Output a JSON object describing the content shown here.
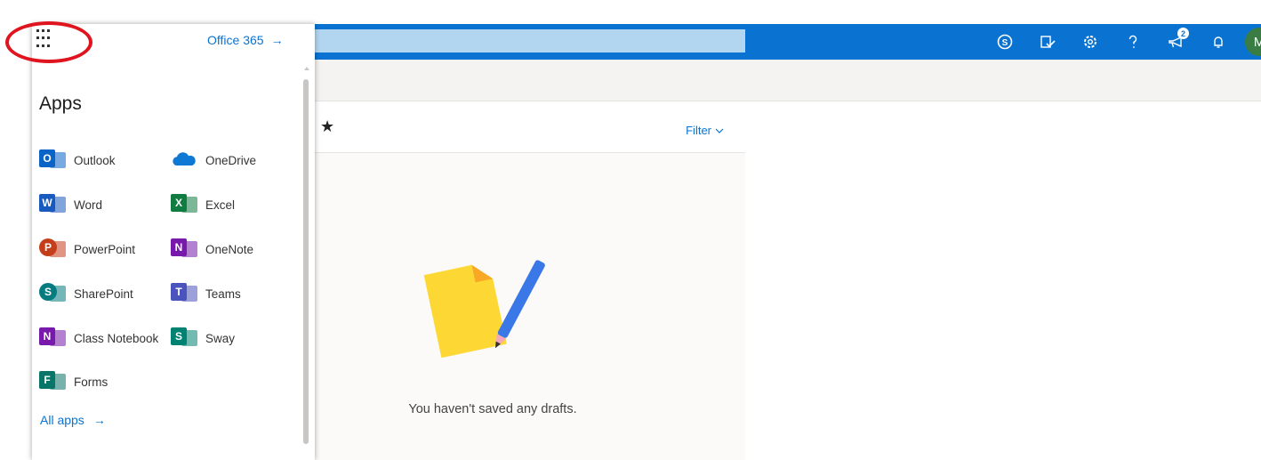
{
  "launcher": {
    "office365_label": "Office 365",
    "apps_heading": "Apps",
    "all_apps_label": "All apps",
    "apps": [
      {
        "label": "Outlook",
        "icon": "outlook-icon",
        "color": "#0a64c8",
        "letter": "O"
      },
      {
        "label": "OneDrive",
        "icon": "onedrive-icon",
        "color": "#0f78d4",
        "letter": ""
      },
      {
        "label": "Word",
        "icon": "word-icon",
        "color": "#185abd",
        "letter": "W"
      },
      {
        "label": "Excel",
        "icon": "excel-icon",
        "color": "#107c41",
        "letter": "X"
      },
      {
        "label": "PowerPoint",
        "icon": "powerpoint-icon",
        "color": "#c43e1c",
        "letter": "P"
      },
      {
        "label": "OneNote",
        "icon": "onenote-icon",
        "color": "#7719aa",
        "letter": "N"
      },
      {
        "label": "SharePoint",
        "icon": "sharepoint-icon",
        "color": "#037b7f",
        "letter": "S"
      },
      {
        "label": "Teams",
        "icon": "teams-icon",
        "color": "#4b53bc",
        "letter": "T"
      },
      {
        "label": "Class Notebook",
        "icon": "class-notebook-icon",
        "color": "#7719aa",
        "letter": "N"
      },
      {
        "label": "Sway",
        "icon": "sway-icon",
        "color": "#008272",
        "letter": "S"
      },
      {
        "label": "Forms",
        "icon": "forms-icon",
        "color": "#077568",
        "letter": "F"
      }
    ]
  },
  "topbar": {
    "notification_count": "2",
    "avatar_initial": "M",
    "accent_color": "#0a73d1"
  },
  "list": {
    "filter_label": "Filter",
    "empty_message": "You haven't saved any drafts."
  }
}
